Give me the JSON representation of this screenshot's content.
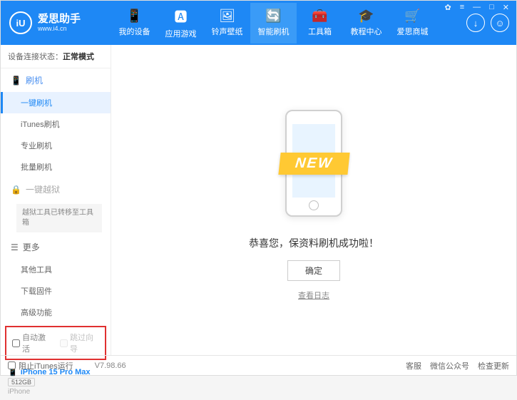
{
  "brand": {
    "name": "爱思助手",
    "url": "www.i4.cn",
    "logo_letters": "iU"
  },
  "title_icons": {
    "skin": "✿",
    "menu": "≡",
    "min": "—",
    "max": "□",
    "close": "✕"
  },
  "nav": [
    {
      "label": "我的设备",
      "icon": "📱"
    },
    {
      "label": "应用游戏",
      "icon": "🅰"
    },
    {
      "label": "铃声壁纸",
      "icon": "🖼"
    },
    {
      "label": "智能刷机",
      "icon": "🔄"
    },
    {
      "label": "工具箱",
      "icon": "🧰"
    },
    {
      "label": "教程中心",
      "icon": "🎓"
    },
    {
      "label": "爱思商城",
      "icon": "🛒"
    }
  ],
  "status": {
    "label": "设备连接状态：",
    "value": "正常模式"
  },
  "sidebar": {
    "flash_title": "刷机",
    "items": [
      "一键刷机",
      "iTunes刷机",
      "专业刷机",
      "批量刷机"
    ],
    "jailbreak_title": "一键越狱",
    "jailbreak_note": "越狱工具已转移至工具箱",
    "more_title": "更多",
    "more_items": [
      "其他工具",
      "下载固件",
      "高级功能"
    ]
  },
  "checkboxes": {
    "auto_activate": "自动激活",
    "skip_guide": "跳过向导"
  },
  "device": {
    "model": "iPhone 15 Pro Max",
    "storage": "512GB",
    "type": "iPhone"
  },
  "main": {
    "ribbon": "NEW",
    "success": "恭喜您，保资料刷机成功啦！",
    "ok": "确定",
    "view_log": "查看日志"
  },
  "footer": {
    "block_itunes": "阻止iTunes运行",
    "version": "V7.98.66",
    "links": [
      "客服",
      "微信公众号",
      "检查更新"
    ]
  }
}
